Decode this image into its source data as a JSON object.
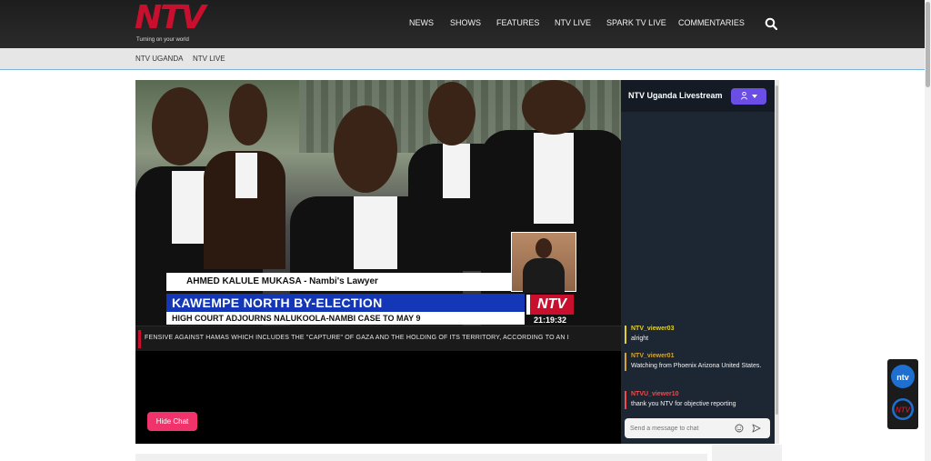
{
  "brand": {
    "logo_text": "NTV",
    "tagline": "Turning on your world",
    "accent_color": "#c8102e"
  },
  "nav": {
    "items": [
      "NEWS",
      "SHOWS",
      "FEATURES",
      "NTV LIVE",
      "SPARK TV LIVE",
      "COMMENTARIES"
    ],
    "search_icon": "search-icon"
  },
  "subnav": {
    "items": [
      "NTV UGANDA",
      "NTV LIVE"
    ]
  },
  "player": {
    "lower_third_name": "AHMED KALULE MUKASA - Nambi's Lawyer",
    "headline": "KAWEMPE NORTH BY-ELECTION",
    "subheadline": "HIGH COURT ADJOURNS NALUKOOLA-NAMBI CASE TO MAY 9",
    "channel_bug": "NTV",
    "clock": "21:19:32",
    "ticker": "FENSIVE AGAINST HAMAS WHICH INCLUDES THE \"CAPTURE\" OF GAZA AND THE HOLDING OF ITS TERRITORY, ACCORDING TO AN I",
    "hide_chat_label": "Hide Chat"
  },
  "chat": {
    "title": "NTV Uganda Livestream",
    "messages": [
      {
        "user": "NTV_viewer03",
        "text": "alright",
        "color": "#e3d12b"
      },
      {
        "user": "NTV_viewer01",
        "text": "Watching from Phoenix Arizona United States.",
        "color": "#d4a533"
      },
      {
        "user": "NTVU_viewer10",
        "text": "thank you NTV for objective reporting",
        "color": "#f04a4a"
      }
    ],
    "input_placeholder": "Send a message to chat"
  }
}
